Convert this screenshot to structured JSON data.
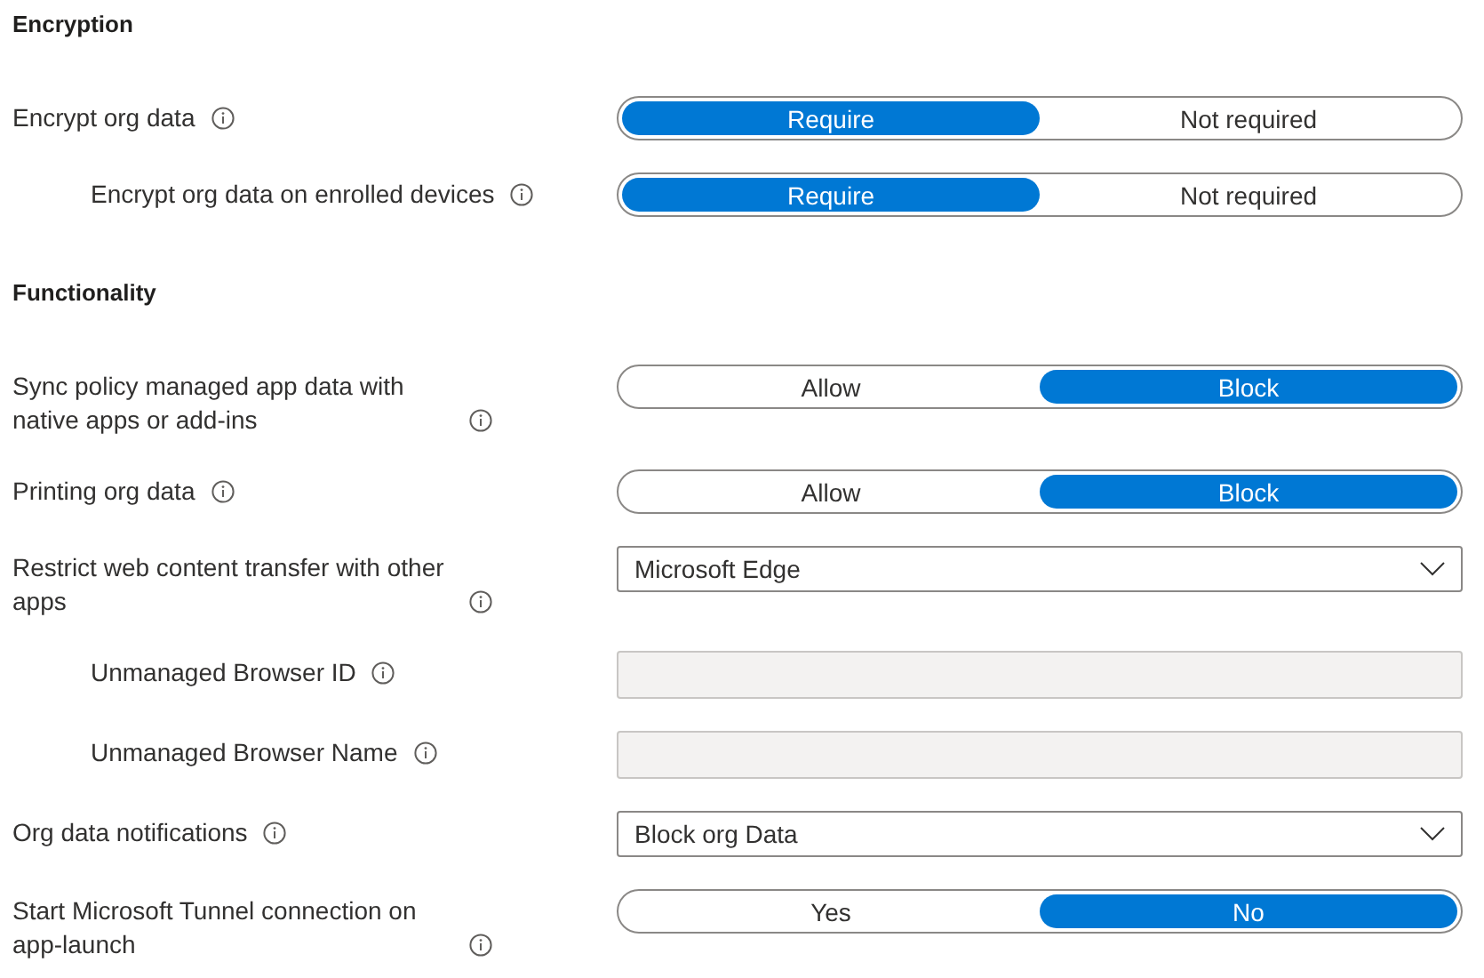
{
  "sections": [
    {
      "title": "Encryption",
      "settings": [
        {
          "label": "Encrypt org data",
          "kind": "toggle",
          "options": [
            {
              "label": "Require",
              "selected": true
            },
            {
              "label": "Not required",
              "selected": false
            }
          ],
          "children": [
            {
              "label": "Encrypt org data on enrolled devices",
              "kind": "toggle",
              "options": [
                {
                  "label": "Require",
                  "selected": true
                },
                {
                  "label": "Not required",
                  "selected": false
                }
              ]
            }
          ]
        }
      ]
    },
    {
      "title": "Functionality",
      "settings": [
        {
          "label": "Sync policy managed app data with native apps or add-ins",
          "kind": "toggle",
          "options": [
            {
              "label": "Allow",
              "selected": false
            },
            {
              "label": "Block",
              "selected": true
            }
          ]
        },
        {
          "label": "Printing org data",
          "kind": "toggle",
          "options": [
            {
              "label": "Allow",
              "selected": false
            },
            {
              "label": "Block",
              "selected": true
            }
          ]
        },
        {
          "label": "Restrict web content transfer with other apps",
          "kind": "dropdown",
          "value": "Microsoft Edge",
          "children": [
            {
              "label": "Unmanaged Browser ID",
              "kind": "text_field",
              "disabled": true
            },
            {
              "label": "Unmanaged Browser Name",
              "kind": "text_field",
              "disabled": true
            }
          ]
        },
        {
          "label": "Org data notifications",
          "kind": "dropdown",
          "value": "Block org Data"
        },
        {
          "label": "Start Microsoft Tunnel connection on app-launch",
          "kind": "toggle",
          "options": [
            {
              "label": "Yes",
              "selected": false
            },
            {
              "label": "No",
              "selected": true
            }
          ]
        }
      ]
    }
  ]
}
